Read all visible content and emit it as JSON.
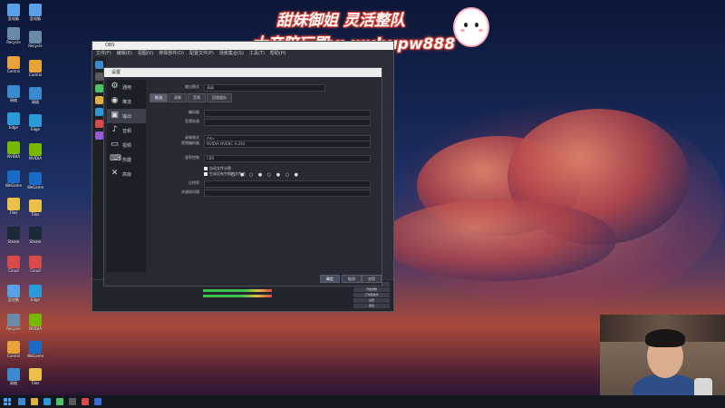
{
  "banner": {
    "line1": "甜妹御姐 灵活整队",
    "line2": "大帝陪玩殿v: wuhupw888"
  },
  "desktop_icons": [
    {
      "label": "此电脑",
      "color": "#5aa0e6"
    },
    {
      "label": "Recycle",
      "color": "#6b8aa8"
    },
    {
      "label": "Control",
      "color": "#e8a23a"
    },
    {
      "label": "网络",
      "color": "#3a8ad0"
    },
    {
      "label": "Edge",
      "color": "#2a9bd8"
    },
    {
      "label": "NVIDIA",
      "color": "#76b900"
    },
    {
      "label": "WeGame",
      "color": "#1a6ac8"
    },
    {
      "label": "Files",
      "color": "#e8c04a"
    },
    {
      "label": "Steam",
      "color": "#1b2838"
    },
    {
      "label": "Cloud",
      "color": "#d84a4a"
    }
  ],
  "obs": {
    "menu": [
      "文件(F)",
      "编辑(E)",
      "视图(V)",
      "停靠部件(D)",
      "配置文件(P)",
      "场景集合(S)",
      "工具(T)",
      "帮助(H)"
    ]
  },
  "settings": {
    "title": "设置",
    "sidebar": [
      {
        "icon": "gear-icon",
        "glyph": "⚙",
        "label": "通用"
      },
      {
        "icon": "stream-icon",
        "glyph": "◉",
        "label": "推流"
      },
      {
        "icon": "output-icon",
        "glyph": "▣",
        "label": "输出"
      },
      {
        "icon": "audio-icon",
        "glyph": "♪",
        "label": "音频"
      },
      {
        "icon": "video-icon",
        "glyph": "▭",
        "label": "视频"
      },
      {
        "icon": "hotkey-icon",
        "glyph": "⌨",
        "label": "热键"
      },
      {
        "icon": "advanced-icon",
        "glyph": "✕",
        "label": "高级"
      }
    ],
    "active_index": 2,
    "tabs": [
      "推流",
      "录像",
      "音频",
      "回放缓存"
    ],
    "fields": [
      {
        "label": "输出模式",
        "value": "高级"
      },
      {
        "label": "编码器",
        "value": ""
      },
      {
        "label": "音频轨道",
        "value": ""
      },
      {
        "label": "录像格式",
        "value": "mkv"
      },
      {
        "label": "视频编码器",
        "value": "NVIDIA NVENC H.264"
      },
      {
        "label": "速率控制",
        "value": "CBR"
      },
      {
        "label": "比特率",
        "value": ""
      },
      {
        "label": "关键帧间隔",
        "value": ""
      }
    ],
    "checkboxes": [
      {
        "label": "自动文件分割",
        "checked": true
      },
      {
        "label": "生成没有空格的文件名",
        "checked": true
      }
    ],
    "buttons": {
      "apply": "确定",
      "cancel": "取消",
      "ok": "应用"
    }
  },
  "obs_bottom": {
    "controls": [
      "开始推流",
      "开始录制",
      "工作室模式",
      "设置",
      "退出"
    ]
  },
  "taskbar": {
    "items": [
      "#3a8ad0",
      "#e0b040",
      "#2a9bd8",
      "#4cc26a",
      "#5a5a5a",
      "#d84a4a",
      "#3a6ad8"
    ]
  },
  "accent": "#d63a2e"
}
